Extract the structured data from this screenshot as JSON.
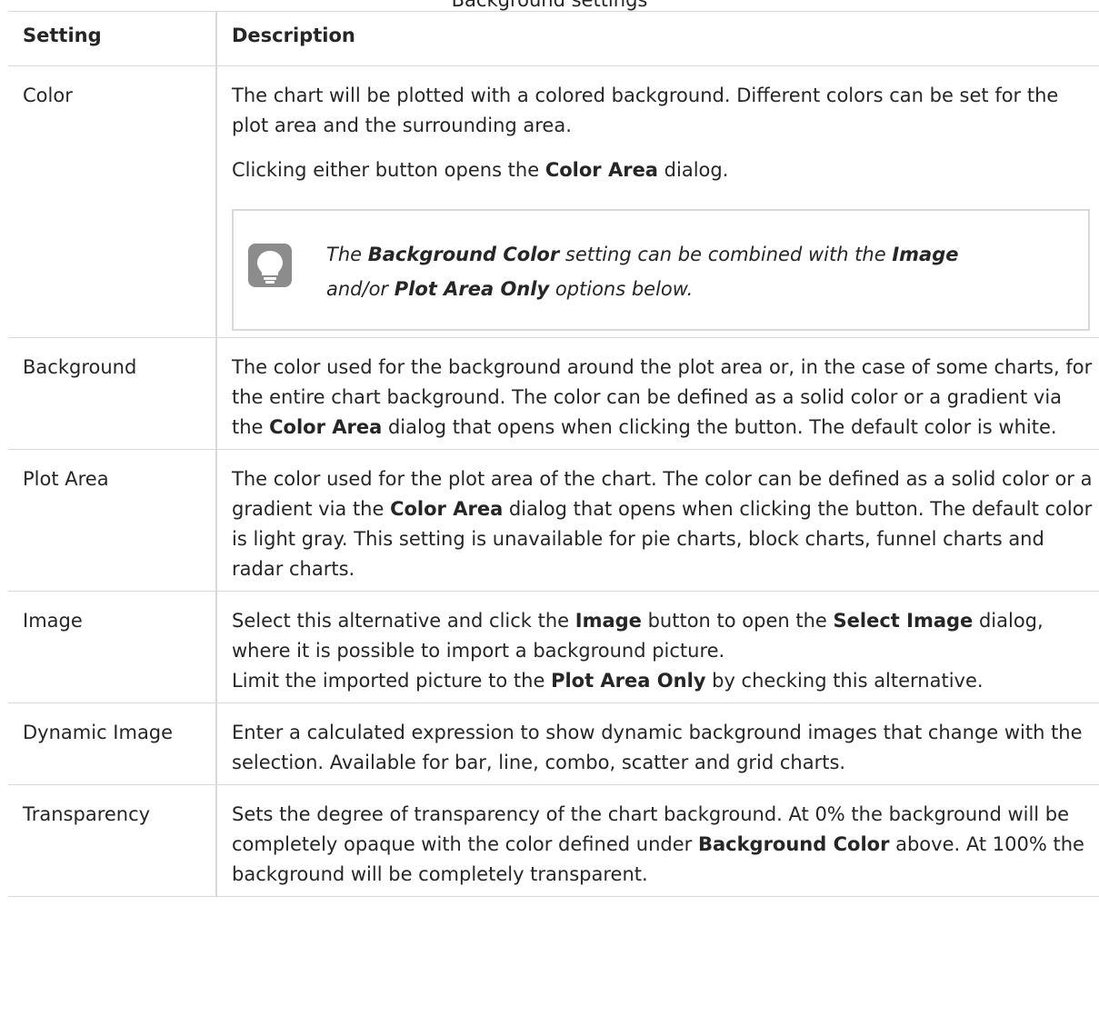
{
  "caption": "Background settings",
  "table": {
    "headers": [
      "Setting",
      "Description"
    ],
    "rows": {
      "color": {
        "setting": "Color",
        "desc1": "The chart will be plotted with a colored background. Different colors can be set for the plot area and the surrounding area.",
        "desc2_pre": "Clicking either button opens the ",
        "desc2_b1": "Color Area",
        "desc2_post": " dialog.",
        "tip": {
          "icon": "lightbulb-icon",
          "t1": "The ",
          "b1": "Background Color",
          "t2": " setting can be combined with the ",
          "b2": "Image",
          "t3": " and/or ",
          "b3": "Plot Area Only",
          "t4": " options below."
        }
      },
      "background": {
        "setting": "Background",
        "t1": "The color used for the background around the plot area or, in the case of some charts, for the entire chart background. The color can be defined as a solid color or a gradient via the ",
        "b1": "Color Area",
        "t2": " dialog that opens when clicking the button. The default color is white."
      },
      "plot_area": {
        "setting": "Plot Area",
        "t1": "The color used for the plot area of the chart. The color can be defined as a solid color or a gradient via the ",
        "b1": "Color Area",
        "t2": " dialog that opens when clicking the button. The default color is light gray. This setting is unavailable for pie charts, block charts, funnel charts and radar charts."
      },
      "image": {
        "setting": "Image",
        "t1": "Select this alternative and click the ",
        "b1": "Image",
        "t2": " button to open the ",
        "b2": "Select Image",
        "t3": " dialog, where it is possible to import a background picture.",
        "t4": "Limit the imported picture to the ",
        "b3": "Plot Area Only",
        "t5": " by checking this alternative."
      },
      "dynamic_image": {
        "setting": "Dynamic Image",
        "t1": "Enter a calculated expression to show dynamic background images that change with the selection. Available for bar, line, combo, scatter and grid charts."
      },
      "transparency": {
        "setting": "Transparency",
        "t1": "Sets the degree of transparency of the chart background. At 0% the background will be completely opaque with the color defined under ",
        "b1": "Background Color",
        "t2": " above. At 100% the background will be completely transparent."
      }
    }
  }
}
